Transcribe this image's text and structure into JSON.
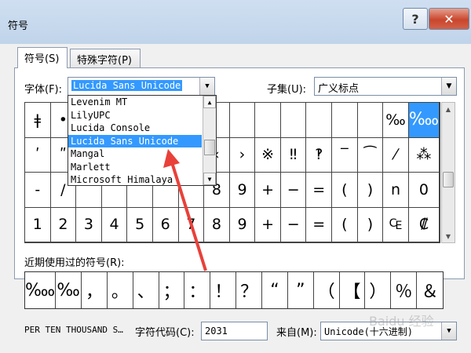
{
  "window": {
    "title": "符号",
    "help": "?",
    "close": "✕"
  },
  "tabs": [
    {
      "label": "符号(S)"
    },
    {
      "label": "特殊字符(P)"
    }
  ],
  "font": {
    "label": "字体(F):",
    "value": "Lucida Sans Unicode"
  },
  "subset": {
    "label": "子集(U):",
    "value": "广义标点"
  },
  "font_dropdown": {
    "items": [
      "Levenim MT",
      "LilyUPC",
      "Lucida Console",
      "Lucida Sans Unicode",
      "Mangal",
      "Marlett",
      "Microsoft Himalaya"
    ],
    "highlighted_index": 3
  },
  "symbol_grid": {
    "rows": [
      [
        "ǂ",
        "•",
        "",
        "",
        "",
        "",
        "",
        "",
        "",
        "",
        "",
        "",
        "",
        "",
        "‰",
        "‱"
      ],
      [
        "ʹ",
        "ʺ",
        "",
        "",
        "",
        "",
        "",
        "‹",
        "›",
        "※",
        "‼",
        "‽",
        "‾",
        "⁀",
        "⁄",
        "⁂"
      ],
      [
        "-",
        "/",
        "",
        "",
        "",
        "",
        "",
        "8",
        "9",
        "+",
        "−",
        "=",
        "(",
        ")",
        "n",
        "0"
      ],
      [
        "1",
        "2",
        "3",
        "4",
        "5",
        "6",
        "7",
        "8",
        "9",
        "+",
        "−",
        "=",
        "(",
        ")",
        "₠",
        "₡"
      ]
    ],
    "selected": "‱"
  },
  "recent": {
    "label": "近期使用过的符号(R):",
    "symbols": [
      "‱",
      "‰",
      "，",
      "。",
      "、",
      "；",
      "：",
      "！",
      "？",
      "“",
      "”",
      "（",
      "【",
      "）",
      "％",
      "＆"
    ]
  },
  "char_name": "PER TEN THOUSAND S…",
  "char_code": {
    "label": "字符代码(C):",
    "value": "2031"
  },
  "from": {
    "label": "来自(M):",
    "value": "Unicode(十六进制)"
  },
  "watermark": "Baidu 经验",
  "colors": {
    "selection": "#3399ff",
    "arrow": "#e8413a"
  },
  "icons": {
    "combo_arrow": "chevron-down-icon",
    "scroll_up": "triangle-up-icon",
    "scroll_down": "triangle-down-icon"
  }
}
